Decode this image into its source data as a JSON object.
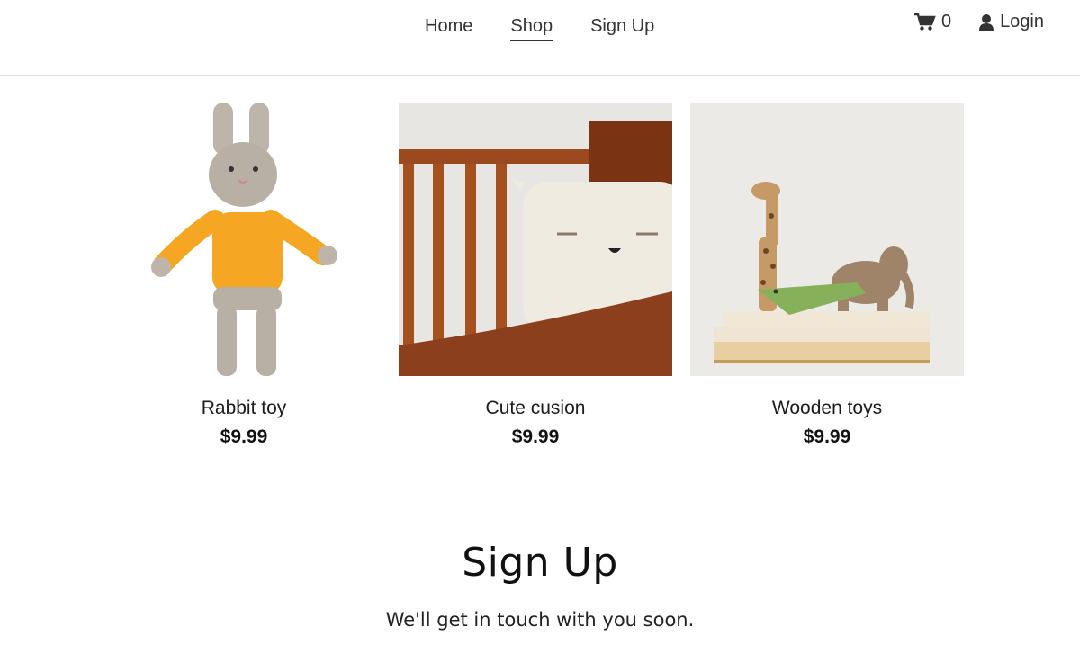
{
  "nav": {
    "items": [
      {
        "label": "Home"
      },
      {
        "label": "Shop"
      },
      {
        "label": "Sign Up"
      }
    ],
    "cart_count": "0",
    "login_label": "Login"
  },
  "products": [
    {
      "name": "Rabbit toy",
      "price": "$9.99"
    },
    {
      "name": "Cute cusion",
      "price": "$9.99"
    },
    {
      "name": "Wooden toys",
      "price": "$9.99"
    }
  ],
  "signup": {
    "title": "Sign Up",
    "subtitle": "We'll get in touch with you soon."
  },
  "colors": {
    "text": "#333333",
    "divider": "#e2e2e2",
    "toy_orange": "#f5a623",
    "wood": "#8b3f1c"
  }
}
